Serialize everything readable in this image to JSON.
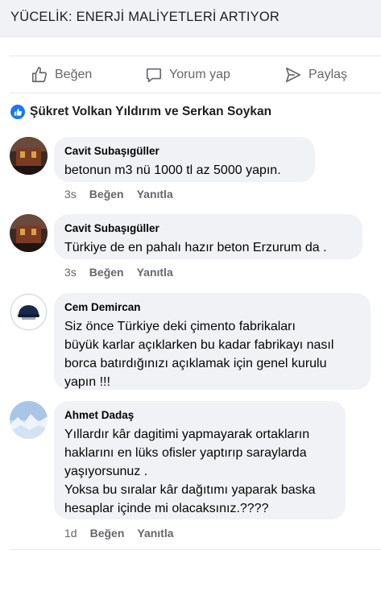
{
  "post": {
    "title": "YÜCELİK: ENERJİ MALİYETLERİ ARTIYOR"
  },
  "actions": {
    "like": "Beğen",
    "comment": "Yorum yap",
    "share": "Paylaş"
  },
  "reactions": {
    "names": "Şükret Volkan Yıldırım ve Serkan Soykan"
  },
  "comments": [
    {
      "author": "Cavit Subaşıgüller",
      "text": "betonun m3 nü 1000 tl az 5000 yapın.",
      "time": "3s",
      "like": "Beğen",
      "reply": "Yanıtla"
    },
    {
      "author": "Cavit Subaşıgüller",
      "text": "Türkiye de en pahalı hazır  beton Erzurum da .",
      "time": "3s",
      "like": "Beğen",
      "reply": "Yanıtla"
    },
    {
      "author": "Cem Demircan",
      "text": "Siz önce Türkiye deki çimento fabrikaları\nbüyük karlar açıklarken bu kadar fabrikayı nasıl\nborca batırdığınızı açıklamak için genel kurulu\nyapın !!!"
    },
    {
      "author": "Ahmet Dadaş",
      "text": "Yıllardır kâr dagitimi yapmayarak ortakların\nhaklarını en lüks ofisler yaptırıp saraylarda\nyaşıyorsunuz .\nYoksa bu sıralar kâr dağıtımı yaparak baska\nhesaplar içinde mi olacaksınız.????",
      "time": "1d",
      "like": "Beğen",
      "reply": "Yanıtla"
    }
  ],
  "colors": {
    "link_blue": "#1877f2",
    "bubble_bg": "#f0f2f5",
    "meta_gray": "#65676b"
  }
}
